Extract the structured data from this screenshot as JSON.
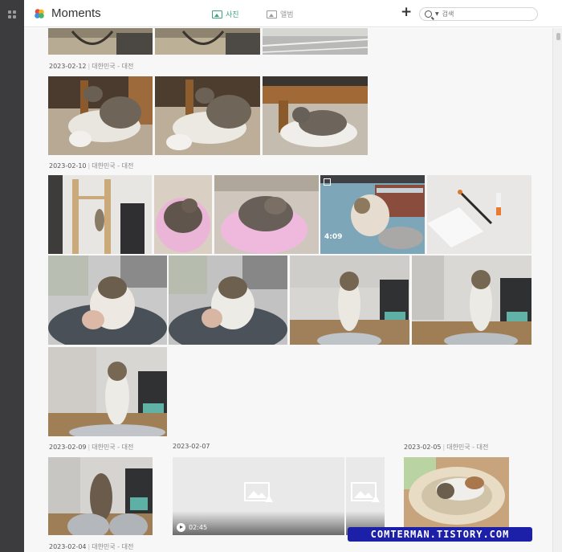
{
  "app": {
    "title": "Moments"
  },
  "tabs": [
    {
      "label": "사진",
      "active": true
    },
    {
      "label": "앨범",
      "active": false
    }
  ],
  "toolbar": {
    "add_label": "+"
  },
  "search": {
    "placeholder": "검색"
  },
  "groups": [
    {
      "date": "2023-02-12",
      "location": "대한민국 - 대전"
    },
    {
      "date": "2023-02-10",
      "location": "대한민국 - 대전"
    },
    {
      "date": "2023-02-09",
      "location": "대한민국 - 대전"
    },
    {
      "date": "2023-02-07",
      "location": ""
    },
    {
      "date": "2023-02-05",
      "location": "대한민국 - 대전"
    },
    {
      "date": "2023-02-04",
      "location": "대한민국 - 대전"
    }
  ],
  "phone_clock": "4:09",
  "videos": [
    {
      "duration": "02:45"
    }
  ],
  "watermark": "COMTERMAN.TISTORY.COM",
  "colors": {
    "accent": "#3aa37f",
    "rail": "#3c3c3e",
    "watermark": "#1c1fa8"
  }
}
